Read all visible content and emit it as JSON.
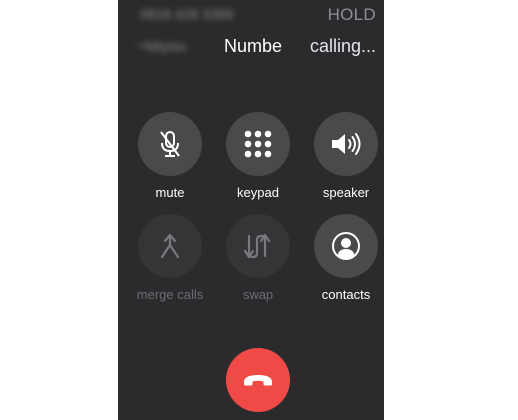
{
  "held_call": {
    "number": "0816 428 3369",
    "status": "HOLD"
  },
  "active_call": {
    "name_blurred": "~Ntiyiso",
    "name": "Numbe",
    "status": "calling..."
  },
  "controls": {
    "mute": {
      "label": "mute",
      "icon": "mic-slash-icon",
      "enabled": true
    },
    "keypad": {
      "label": "keypad",
      "icon": "keypad-icon",
      "enabled": true
    },
    "speaker": {
      "label": "speaker",
      "icon": "speaker-icon",
      "enabled": true
    },
    "merge": {
      "label": "merge calls",
      "icon": "merge-icon",
      "enabled": false
    },
    "swap": {
      "label": "swap",
      "icon": "swap-icon",
      "enabled": false
    },
    "contacts": {
      "label": "contacts",
      "icon": "contact-icon",
      "enabled": true
    }
  },
  "end_call": {
    "icon": "end-call-icon",
    "color": "#f04a47"
  },
  "colors": {
    "background": "#2b2b2d",
    "button": "#4a4a4d",
    "end_call": "#f04a47"
  }
}
